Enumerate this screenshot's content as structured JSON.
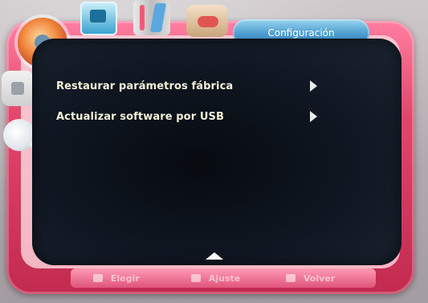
{
  "header": {
    "title": "Configuración",
    "category_icons": [
      "gear-icon",
      "tv-icon",
      "media-icon",
      "tools-icon",
      "lock-icon",
      "magnifier-icon"
    ]
  },
  "menu": {
    "items": [
      {
        "label": "Restaurar parámetros fábrica",
        "icon": "arrow-right-icon"
      },
      {
        "label": "Actualizar software por USB",
        "icon": "arrow-right-icon"
      }
    ]
  },
  "helpbar": {
    "select": "Elegir",
    "adjust": "Ajuste",
    "back": "Volver"
  },
  "colors": {
    "frame": "#e1476b",
    "panel": "#101722",
    "menu_text": "#f3f0d8",
    "title_tab": "#4a9bcd"
  }
}
